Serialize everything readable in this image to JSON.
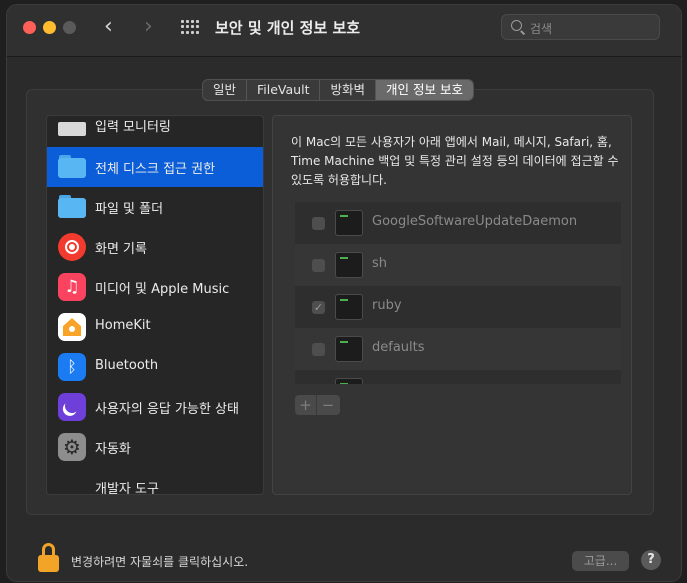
{
  "window": {
    "title": "보안 및 개인 정보 보호",
    "search_placeholder": "검색"
  },
  "tabs": [
    {
      "label": "일반",
      "active": false
    },
    {
      "label": "FileVault",
      "active": false
    },
    {
      "label": "방화벽",
      "active": false
    },
    {
      "label": "개인 정보 보호",
      "active": true
    }
  ],
  "sidebar": {
    "items": [
      {
        "label": "입력 모니터링",
        "icon": "keyboard-icon"
      },
      {
        "label": "전체 디스크 접근 권한",
        "icon": "folder-icon",
        "selected": true
      },
      {
        "label": "파일 및 폴더",
        "icon": "folder-icon"
      },
      {
        "label": "화면 기록",
        "icon": "screen-record-icon"
      },
      {
        "label": "미디어 및 Apple Music",
        "icon": "music-note-icon"
      },
      {
        "label": "HomeKit",
        "icon": "home-icon"
      },
      {
        "label": "Bluetooth",
        "icon": "bluetooth-icon"
      },
      {
        "label": "사용자의 응답 가능한 상태",
        "icon": "moon-icon"
      },
      {
        "label": "자동화",
        "icon": "gear-icon"
      },
      {
        "label": "개발자 도구",
        "icon": ""
      }
    ]
  },
  "content": {
    "description": "이 Mac의 모든 사용자가 아래 앱에서 Mail, 메시지, Safari, 홈, Time Machine 백업 및 특정 관리 설정 등의 데이터에 접근할 수 있도록 허용합니다.",
    "apps": [
      {
        "name": "GoogleSoftwareUpdateDaemon",
        "checked": false
      },
      {
        "name": "sh",
        "checked": false
      },
      {
        "name": "ruby",
        "checked": true
      },
      {
        "name": "defaults",
        "checked": false
      }
    ],
    "add_label": "+",
    "remove_label": "−"
  },
  "footer": {
    "lock_text": "변경하려면 자물쇠를 클릭하십시오.",
    "advanced_label": "고급...",
    "help_label": "?"
  },
  "colors": {
    "accent": "#0b5ed7",
    "lock": "#f2a428"
  }
}
